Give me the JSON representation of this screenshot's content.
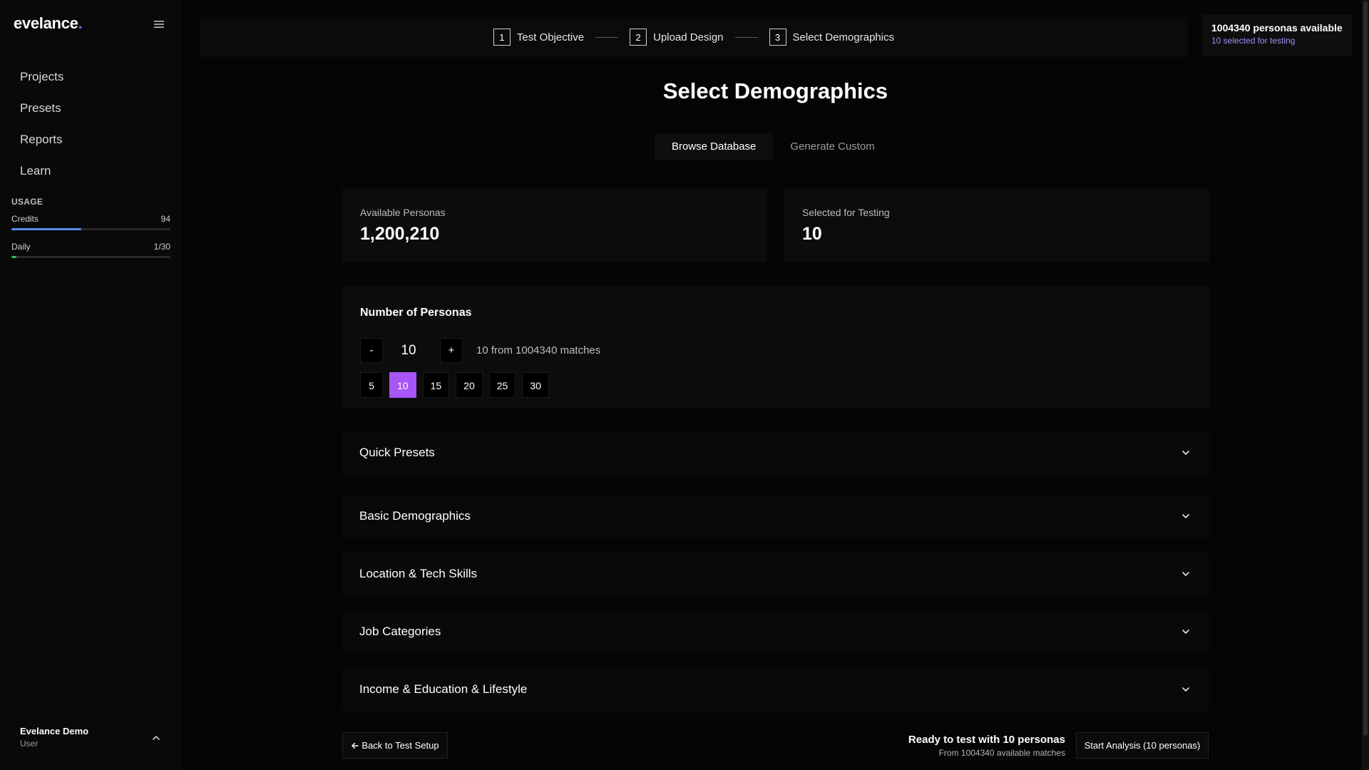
{
  "app": {
    "logo_text": "evelance",
    "logo_dot": ".",
    "accent_color": "#a855f7"
  },
  "sidebar": {
    "nav_items": [
      {
        "label": "Projects",
        "icon": "folder-icon"
      },
      {
        "label": "Presets",
        "icon": "preset-icon"
      },
      {
        "label": "Reports",
        "icon": "report-icon"
      },
      {
        "label": "Learn",
        "icon": "book-icon"
      }
    ],
    "usage": {
      "title": "USAGE",
      "credits_label": "Credits",
      "credits_value": "94",
      "credits_fill_fraction": 0.44,
      "credits_color": "#5b8def",
      "daily_label": "Daily",
      "daily_value": "1/30",
      "daily_fill_fraction": 0.033,
      "daily_color": "#22c55e"
    },
    "user": {
      "name": "Evelance Demo",
      "role": "User"
    }
  },
  "stepper": {
    "steps": [
      {
        "number": "1",
        "label": "Test Objective"
      },
      {
        "number": "2",
        "label": "Upload Design"
      },
      {
        "number": "3",
        "label": "Select Demographics"
      }
    ]
  },
  "personas_box": {
    "title": "1004340 personas available",
    "subtitle": "10 selected for testing"
  },
  "main": {
    "title": "Select Demographics",
    "tabs": [
      {
        "label": "Browse Database",
        "active": true
      },
      {
        "label": "Generate Custom",
        "active": false
      }
    ],
    "stats": {
      "available_label": "Available Personas",
      "available_value": "1,200,210",
      "selected_label": "Selected for Testing",
      "selected_value": "10"
    },
    "persona_count": {
      "title": "Number of Personas",
      "minus_label": "-",
      "plus_label": "+",
      "value": "10",
      "match_text": "10 from 1004340 matches",
      "presets": [
        "5",
        "10",
        "15",
        "20",
        "25",
        "30"
      ],
      "active_preset": "10"
    },
    "sections": [
      "Quick Presets",
      "Basic Demographics",
      "Location & Tech Skills",
      "Job Categories",
      "Income & Education & Lifestyle"
    ]
  },
  "footer": {
    "back_label": "Back to Test Setup",
    "ready_title": "Ready to test with 10 personas",
    "ready_sub": "From 1004340 available matches",
    "start_label": "Start Analysis (10 personas)"
  }
}
